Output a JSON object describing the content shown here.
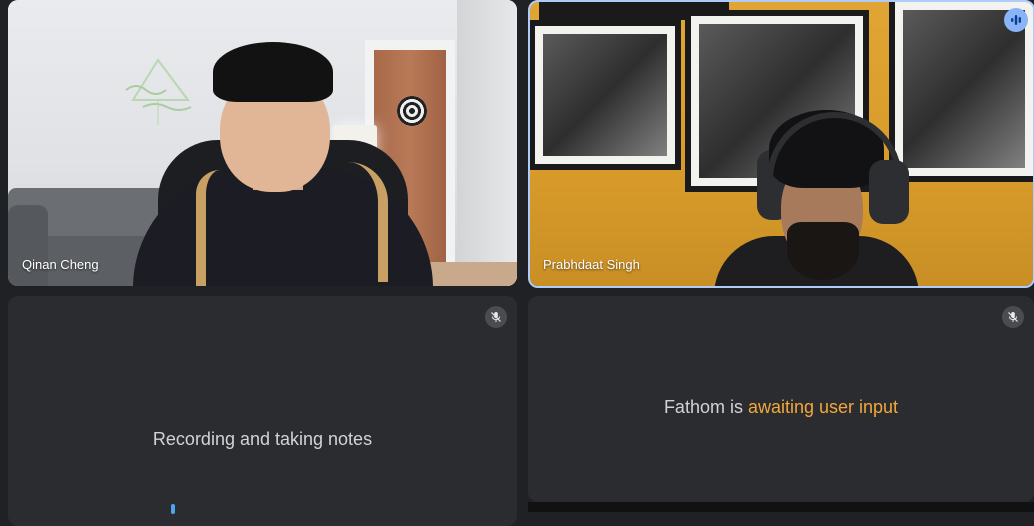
{
  "participants": [
    {
      "name": "Qinan Cheng"
    },
    {
      "name": "Prabhdaat Singh",
      "speaking": true
    }
  ],
  "tiles": {
    "recording": {
      "status_text": "Recording and taking notes"
    },
    "fathom": {
      "status_prefix": "Fathom is ",
      "status_highlight": "awaiting user input"
    }
  },
  "icons": {
    "speaking": "audio-bars-icon",
    "muted": "mic-off-icon"
  },
  "colors": {
    "background": "#202124",
    "tile": "#2b2c2f",
    "active_speaker_ring": "#aecbfa",
    "speaking_indicator": "#8ab4f8",
    "fathom_accent": "#f2a73b",
    "audio_level": "#4fa3f7"
  }
}
